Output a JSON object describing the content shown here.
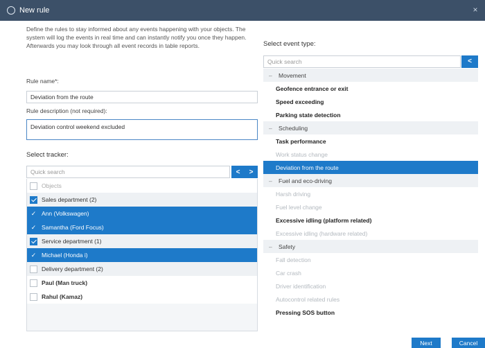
{
  "dialog": {
    "title": "New rule"
  },
  "left": {
    "intro": "Define the rules to stay informed about any events happening with your objects. The system will log the events in real time and can instantly notify you once they happen. Afterwards you may look through all event records in table reports.",
    "rule_name_label": "Rule name*:",
    "rule_name_value": "Deviation from the route",
    "rule_desc_label": "Rule description (not required):",
    "rule_desc_value": "Deviation control weekend excluded",
    "select_tracker_title": "Select tracker:",
    "tracker_search_placeholder": "Quick search",
    "arrows": {
      "left": "<",
      "right": ">"
    },
    "trackers": [
      {
        "label": "Objects",
        "kind": "header"
      },
      {
        "label": "Sales department (2)",
        "kind": "group"
      },
      {
        "label": "Ann (Volkswagen)",
        "kind": "selected"
      },
      {
        "label": "Samantha (Ford Focus)",
        "kind": "selected"
      },
      {
        "label": "Service department (1)",
        "kind": "group"
      },
      {
        "label": "Michael (Honda i)",
        "kind": "selected"
      },
      {
        "label": "Delivery department (2)",
        "kind": "group-unchecked"
      },
      {
        "label": "Paul (Man truck)",
        "kind": "item"
      },
      {
        "label": "Rahul (Kamaz)",
        "kind": "item"
      }
    ]
  },
  "right": {
    "select_event_title": "Select event type:",
    "event_search_placeholder": "Quick search",
    "event_search_button": "<",
    "events": [
      {
        "label": "Movement",
        "kind": "cat"
      },
      {
        "label": "Geofence entrance or exit",
        "kind": "bold"
      },
      {
        "label": "Speed exceeding",
        "kind": "bold"
      },
      {
        "label": "Parking state detection",
        "kind": "bold"
      },
      {
        "label": "Scheduling",
        "kind": "cat"
      },
      {
        "label": "Task performance",
        "kind": "bold"
      },
      {
        "label": "Work status change",
        "kind": "dim"
      },
      {
        "label": "Deviation from the route",
        "kind": "sel"
      },
      {
        "label": "Fuel and eco-driving",
        "kind": "cat"
      },
      {
        "label": "Harsh driving",
        "kind": "dim"
      },
      {
        "label": "Fuel level change",
        "kind": "dim"
      },
      {
        "label": "Excessive idling (platform related)",
        "kind": "bold"
      },
      {
        "label": "Excessive idling (hardware related)",
        "kind": "dim"
      },
      {
        "label": "Safety",
        "kind": "cat"
      },
      {
        "label": "Fall detection",
        "kind": "dim"
      },
      {
        "label": "Car crash",
        "kind": "dim"
      },
      {
        "label": "Driver identification",
        "kind": "dim"
      },
      {
        "label": "Autocontrol related rules",
        "kind": "dim"
      },
      {
        "label": "Pressing SOS button",
        "kind": "bold"
      }
    ]
  },
  "footer": {
    "next_label": "Next",
    "cancel_label": "Cancel"
  },
  "colors": {
    "titlebar": "#3c5068",
    "accent": "#1e7ac9"
  }
}
